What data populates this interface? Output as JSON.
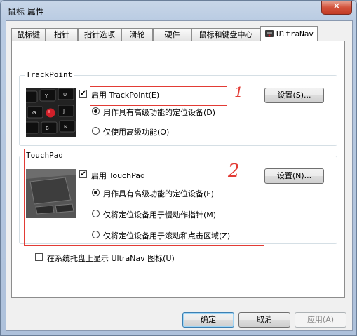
{
  "window": {
    "title": "鼠标 属性",
    "close_glyph": "✕"
  },
  "tabs": [
    {
      "label": "鼠标键",
      "active": false
    },
    {
      "label": "指针",
      "active": false
    },
    {
      "label": "指针选项",
      "active": false
    },
    {
      "label": "滑轮",
      "active": false
    },
    {
      "label": "硬件",
      "active": false
    },
    {
      "label": "鼠标和键盘中心",
      "active": false
    },
    {
      "label": "UltraNav",
      "active": true
    }
  ],
  "trackpoint": {
    "group_title": "TrackPoint",
    "enable_label": "启用 TrackPoint(E)",
    "enable_checked": true,
    "settings_button": "设置(S)...",
    "option_full": "用作具有高级功能的定位设备(D)",
    "option_full_selected": true,
    "option_advanced": "仅使用高级功能(O)",
    "option_advanced_selected": false
  },
  "touchpad": {
    "group_title": "TouchPad",
    "enable_label": "启用 TouchPad",
    "enable_checked": true,
    "settings_button": "设置(N)...",
    "option_full": "用作具有高级功能的定位设备(F)",
    "option_full_selected": true,
    "option_slow": "仅将定位设备用于慢动作指针(M)",
    "option_slow_selected": false,
    "option_scroll": "仅将定位设备用于滚动和点击区域(Z)",
    "option_scroll_selected": false
  },
  "tray_icon": {
    "label": "在系统托盘上显示 UltraNav 图标(U)",
    "checked": false
  },
  "footer": {
    "ok": "确定",
    "cancel": "取消",
    "apply": "应用(A)"
  },
  "annotations": {
    "mark_1": "1",
    "mark_2": "2",
    "color": "#e23b35"
  },
  "colors": {
    "trackpoint_nub": "#d0202a",
    "titlebar": "#b9cbe2"
  }
}
